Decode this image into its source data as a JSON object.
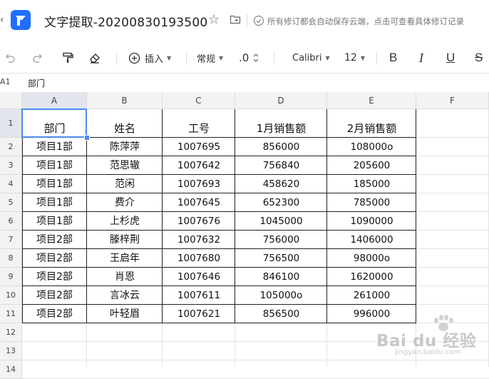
{
  "window": {
    "title": "文字提取-20200830193500",
    "save_status": "所有修订都会自动保存云端，点击可查看具体修订记录"
  },
  "toolbar": {
    "insert_label": "插入",
    "format_label": "常规",
    "decimal_label": ".0",
    "font_name": "Calibri",
    "font_size": "12",
    "bold": "B",
    "italic": "I",
    "underline": "U",
    "strike": "S"
  },
  "formula_bar": {
    "cell_ref": "A1",
    "content": "部门"
  },
  "sheet": {
    "columns": [
      "A",
      "B",
      "C",
      "D",
      "E",
      "F"
    ],
    "rows": [
      "1",
      "2",
      "3",
      "4",
      "5",
      "6",
      "7",
      "8",
      "9",
      "10",
      "11",
      "12",
      "13",
      "14"
    ],
    "header": [
      "部门",
      "姓名",
      "工号",
      "1月销售额",
      "2月销售额"
    ],
    "data": [
      [
        "项目1部",
        "陈萍萍",
        "1007695",
        "856000",
        "108000o"
      ],
      [
        "项目1部",
        "范思辙",
        "1007642",
        "756840",
        "205600"
      ],
      [
        "项目1部",
        "范闲",
        "1007693",
        "458620",
        "185000"
      ],
      [
        "项目1部",
        "费介",
        "1007645",
        "652300",
        "785000"
      ],
      [
        "项目1部",
        "上杉虎",
        "1007676",
        "1045000",
        "1090000"
      ],
      [
        "项目2部",
        "滕梓荆",
        "1007632",
        "756000",
        "1406000"
      ],
      [
        "项目2部",
        "王启年",
        "1007680",
        "756500",
        "98000o"
      ],
      [
        "项目2部",
        "肖恩",
        "1007646",
        "846100",
        "1620000"
      ],
      [
        "项目2部",
        "言冰云",
        "1007611",
        "105000o",
        "261000"
      ],
      [
        "项目2部",
        "叶轻眉",
        "1007621",
        "856500",
        "996000"
      ]
    ]
  },
  "watermark": {
    "brand": "Bai du 经验",
    "url": "jingyan.baidu.com"
  },
  "colors": {
    "accent": "#4a8af4",
    "logo": "#1e6fff"
  }
}
